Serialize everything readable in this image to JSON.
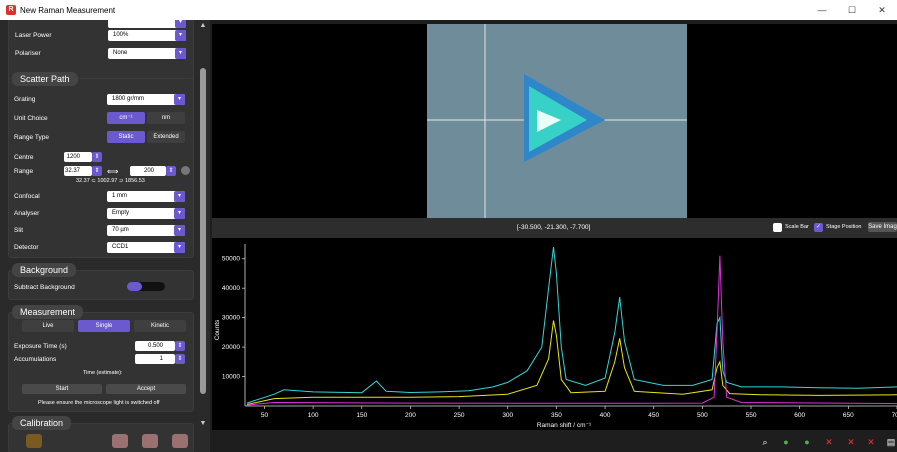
{
  "window": {
    "title": "New Raman Measurement",
    "app_icon": "R",
    "minimize": "—",
    "maximize": "☐",
    "close": "✕"
  },
  "laser": {
    "power_label": "Laser Power",
    "power_value": "100%",
    "polariser_label": "Polariser",
    "polariser_value": "None"
  },
  "scatter": {
    "title": "Scatter Path",
    "grating_label": "Grating",
    "grating_value": "1800 gr/mm",
    "unit_label": "Unit Choice",
    "unit_options": [
      "cm⁻¹",
      "nm"
    ],
    "range_type_label": "Range Type",
    "range_type_options": [
      "Static",
      "Extended"
    ],
    "centre_label": "Centre",
    "centre_value": "1200",
    "range_label": "Range",
    "range_low": "32.37",
    "range_high": "200",
    "range_summary": "32.37 ⊂ 1002.97 ⊃ 1856.53",
    "confocal_label": "Confocal",
    "confocal_value": "1 mm",
    "analyser_label": "Analyser",
    "analyser_value": "Empty",
    "slit_label": "Slit",
    "slit_value": "70 µm",
    "detector_label": "Detector",
    "detector_value": "CCD1"
  },
  "background": {
    "title": "Background",
    "subtract_label": "Subtract Background"
  },
  "measurement": {
    "title": "Measurement",
    "modes": [
      "Live",
      "Single",
      "Kinetic"
    ],
    "exposure_label": "Exposure Time (s)",
    "exposure_value": "0.500",
    "accum_label": "Accumulations",
    "accum_value": "1",
    "time_est_label": "Time (estimate):",
    "start_label": "Start",
    "accept_label": "Accept",
    "note": "Please ensure the microscope light is switched off"
  },
  "calibration": {
    "title": "Calibration"
  },
  "camera": {
    "coords": "[-30.500, -21.300, -7.700]",
    "scale_bar_label": "Scale Bar",
    "stage_position_label": "Stage Position",
    "save_image_label": "Save Imag"
  },
  "colors": {
    "accent": "#6a5acd",
    "cyan": "#35d6d6",
    "yellow": "#e6e619",
    "magenta": "#e030e0"
  },
  "chart_data": {
    "type": "line",
    "xlabel": "Raman shift / cm⁻¹",
    "ylabel": "Counts",
    "xlim": [
      30,
      700
    ],
    "ylim": [
      0,
      55000
    ],
    "xticks": [
      50,
      100,
      150,
      200,
      250,
      300,
      350,
      400,
      450,
      500,
      550,
      600,
      650,
      700
    ],
    "yticks": [
      10000,
      20000,
      30000,
      40000,
      50000
    ],
    "grid": false,
    "series": [
      {
        "color": "#35d6d6",
        "x": [
          32,
          60,
          70,
          100,
          150,
          165,
          175,
          200,
          230,
          260,
          285,
          300,
          320,
          335,
          342,
          347,
          350,
          355,
          360,
          380,
          400,
          410,
          415,
          420,
          430,
          460,
          490,
          510,
          515,
          518,
          521,
          525,
          540,
          580,
          620,
          660,
          700
        ],
        "y": [
          1000,
          4000,
          5500,
          4800,
          4500,
          8500,
          5000,
          4600,
          4800,
          5200,
          6500,
          8000,
          12000,
          20000,
          40000,
          54000,
          45000,
          20000,
          9000,
          7000,
          9500,
          25000,
          37000,
          22000,
          9000,
          7000,
          7000,
          9000,
          28000,
          30000,
          12000,
          8000,
          6500,
          6500,
          6200,
          6000,
          6500
        ]
      },
      {
        "color": "#e6e619",
        "x": [
          32,
          60,
          100,
          150,
          200,
          250,
          300,
          330,
          342,
          347,
          350,
          355,
          365,
          400,
          410,
          415,
          420,
          430,
          480,
          510,
          515,
          518,
          521,
          528,
          560,
          620,
          700
        ],
        "y": [
          500,
          2500,
          3000,
          3000,
          3000,
          3200,
          4000,
          7000,
          16000,
          29000,
          24000,
          9000,
          4500,
          5000,
          15000,
          23000,
          13000,
          5000,
          4000,
          5500,
          13000,
          15000,
          7000,
          4200,
          3800,
          3600,
          3800
        ]
      },
      {
        "color": "#e030e0",
        "x": [
          32,
          60,
          200,
          400,
          500,
          512,
          515,
          518,
          521,
          525,
          540,
          700
        ],
        "y": [
          300,
          1200,
          1000,
          900,
          1000,
          3000,
          25000,
          51000,
          22000,
          3000,
          1200,
          800
        ]
      }
    ]
  }
}
